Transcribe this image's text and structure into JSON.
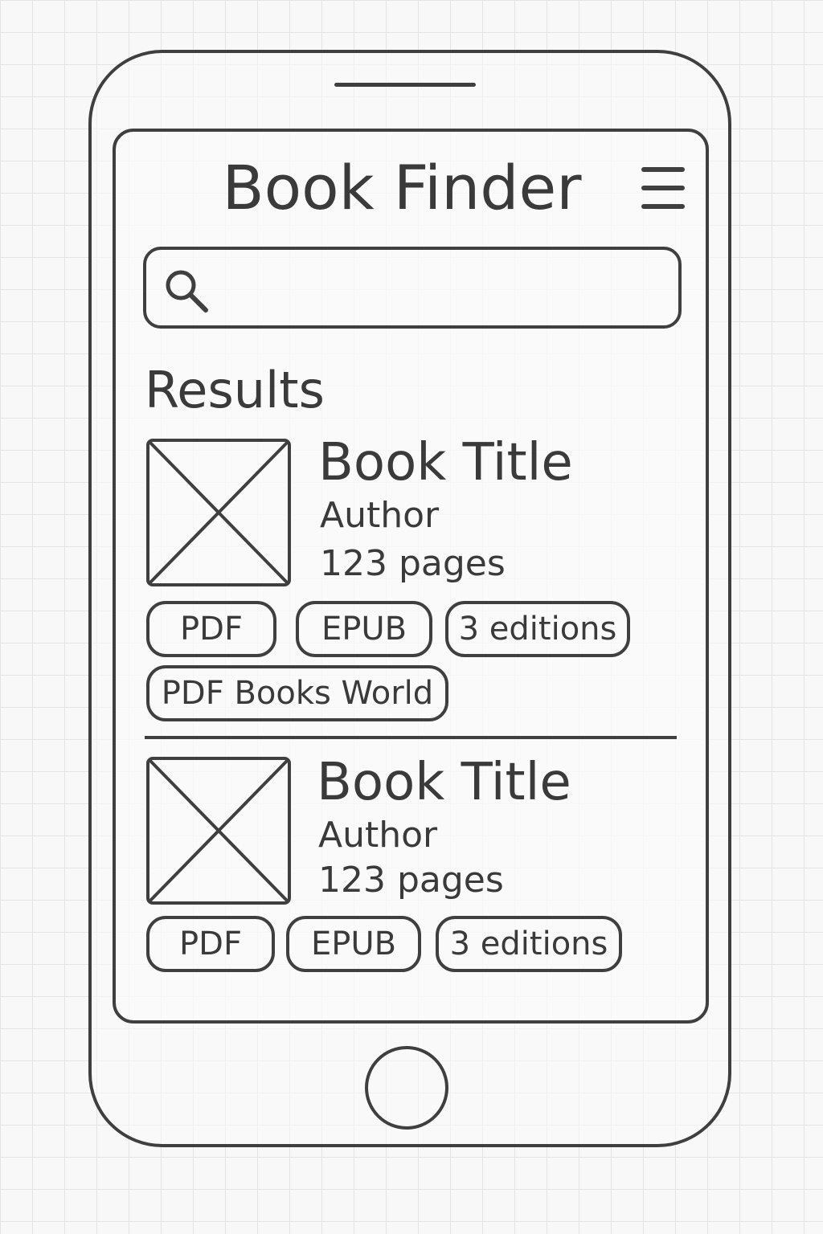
{
  "header": {
    "title": "Book Finder"
  },
  "search": {
    "value": "",
    "icon": "search-icon"
  },
  "results_heading": "Results",
  "results": [
    {
      "title": "Book Title",
      "author": "Author",
      "pages": "123 pages",
      "chips": [
        "PDF",
        "EPUB",
        "3 editions",
        "PDF Books World"
      ]
    },
    {
      "title": "Book Title",
      "author": "Author",
      "pages": "123 pages",
      "chips": [
        "PDF",
        "EPUB",
        "3 editions"
      ]
    }
  ],
  "colors": {
    "stroke": "#3f3f3f",
    "text": "#3a3a3a",
    "background": "#f8f8f8",
    "grid": "#e4e4e4"
  }
}
